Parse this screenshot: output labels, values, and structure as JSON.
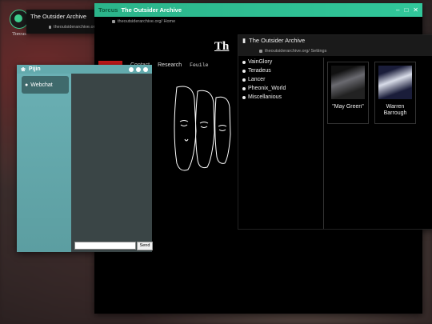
{
  "desktop": {
    "icon_label": "Torcus"
  },
  "back_window": {
    "title": "The Outsider Archive",
    "url": "theoutsiderarchive.org/"
  },
  "main_window": {
    "brand": "Torcus",
    "title": "The Outsider Archive",
    "url": "theoutsiderarchive.org/ Home",
    "heading": "Th",
    "nav": [
      "Contact",
      "Research",
      "Feuile"
    ],
    "colors": {
      "titlebar": "#2bb48a",
      "nav_accent": "#c21818"
    }
  },
  "chat_window": {
    "title": "Pijin",
    "room": "Webchat",
    "input_value": "",
    "send_label": "Send"
  },
  "settings_window": {
    "title": "The Outsider Archive",
    "url": "theoutsiderarchive.org/ Settings",
    "list": [
      "VainGlory",
      "Teradeus",
      "Lancer",
      "Pheonix_World",
      "Miscellanious"
    ],
    "cards": [
      {
        "name": "\"May Green\""
      },
      {
        "name": "Warren Barrough"
      }
    ]
  }
}
